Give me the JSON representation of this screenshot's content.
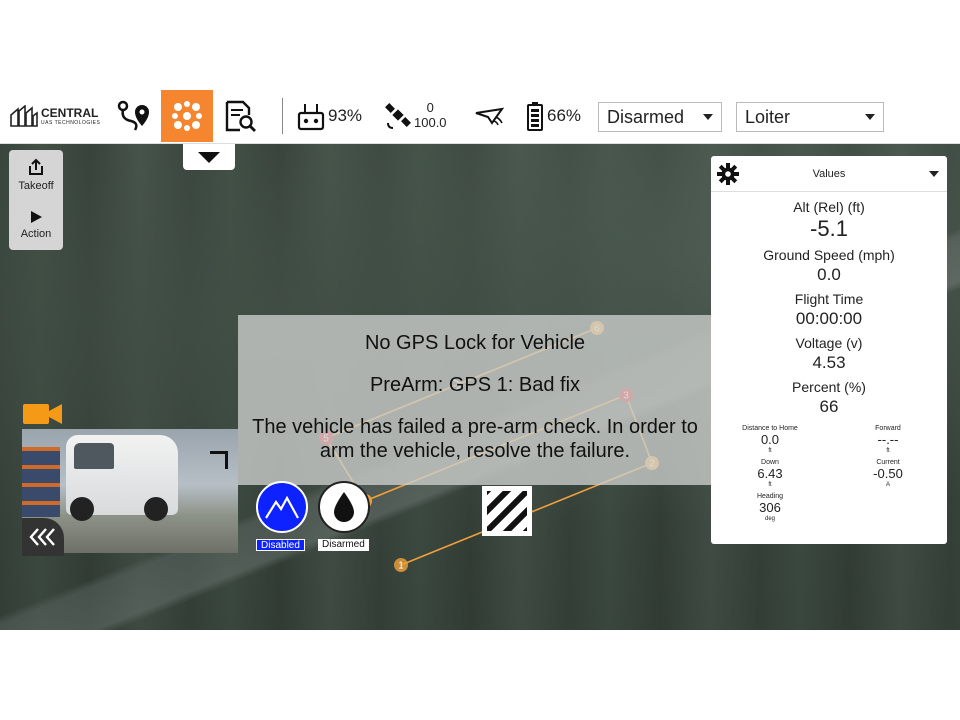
{
  "toolbar": {
    "logo": {
      "brand": "CENTRAL",
      "sub": "UAS TECHNOLOGIES"
    },
    "plan_icon": "route-plan-icon",
    "fly_icon": "drone-fly-icon",
    "analyze_icon": "analyze-icon",
    "rc_signal": "93%",
    "gps_count": "0",
    "gps_hdop": "100.0",
    "battery": "66%",
    "arm_state": "Disarmed",
    "flight_mode": "Loiter",
    "accent": "#f5852e"
  },
  "toolstrip": {
    "takeoff_label": "Takeoff",
    "action_label": "Action"
  },
  "mission": {
    "waypoint_labels": [
      "1",
      "2",
      "3",
      "4",
      "5",
      "6"
    ],
    "path_color": "#f0a03a",
    "active_waypoint_color": "#e01e2a"
  },
  "values_panel": {
    "title": "Values",
    "alt_label": "Alt (Rel) (ft)",
    "alt_value": "-5.1",
    "ground_speed_label": "Ground Speed (mph)",
    "ground_speed_value": "0.0",
    "flight_time_label": "Flight Time",
    "flight_time_value": "00:00:00",
    "voltage_label": "Voltage (v)",
    "voltage_value": "4.53",
    "percent_label": "Percent (%)",
    "percent_value": "66",
    "small": [
      {
        "label": "Distance to Home",
        "value": "0.0",
        "unit": "ft"
      },
      {
        "label": "Forward",
        "value": "--.--",
        "unit": "ft"
      },
      {
        "label": "Down",
        "value": "6.43",
        "unit": "ft"
      },
      {
        "label": "Current",
        "value": "-0.50",
        "unit": "A"
      },
      {
        "label": "Heading",
        "value": "306",
        "unit": "deg"
      }
    ]
  },
  "message": {
    "line1": "No GPS Lock for Vehicle",
    "line2": "PreArm: GPS 1: Bad fix",
    "line3": "The vehicle has failed a pre-arm check. In order to arm the vehicle, resolve the failure."
  },
  "bottom": {
    "terrain_caption": "Disabled",
    "drop_caption": "Disarmed"
  }
}
